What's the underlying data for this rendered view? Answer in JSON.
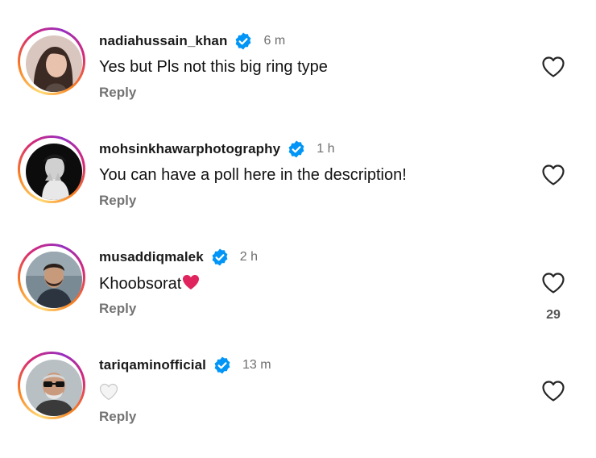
{
  "reply_label": "Reply",
  "colors": {
    "verified_blue": "#0095f6",
    "ring_gradient": [
      "#feda75",
      "#fa7e1e",
      "#d62976",
      "#962fbf"
    ],
    "heart_red": "#e0245e"
  },
  "comments": [
    {
      "username": "nadiahussain_khan",
      "verified": true,
      "time": "6 m",
      "text": "Yes but Pls not this big ring type",
      "likes": ""
    },
    {
      "username": "mohsinkhawarphotography",
      "verified": true,
      "time": "1 h",
      "text": "You can have a poll here in the description!",
      "likes": ""
    },
    {
      "username": "musaddiqmalek",
      "verified": true,
      "time": "2 h",
      "text": "Khoobsorat",
      "emoji": "red-heart-emoji",
      "likes": "29"
    },
    {
      "username": "tariqaminofficial",
      "verified": true,
      "time": "13 m",
      "text": "",
      "emoji": "white-heart-emoji",
      "likes": ""
    }
  ]
}
